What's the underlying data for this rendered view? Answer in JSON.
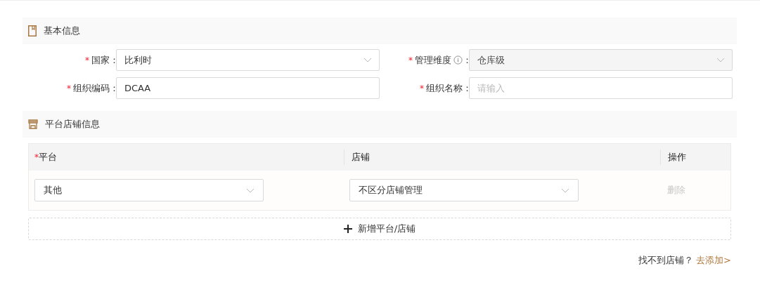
{
  "required_mark": "*",
  "colon": "：",
  "basic_section": {
    "title": "基本信息",
    "fields": [
      {
        "label": "国家",
        "required": true,
        "kind": "select",
        "value": "比利时",
        "disabled": false
      },
      {
        "label": "管理维度",
        "required": true,
        "kind": "select",
        "value": "仓库级",
        "disabled": true,
        "info": true
      },
      {
        "label": "组织编码",
        "required": true,
        "kind": "input",
        "value": "DCAA",
        "disabled": false
      },
      {
        "label": "组织名称",
        "required": true,
        "kind": "input",
        "placeholder": "请输入",
        "disabled": false
      }
    ]
  },
  "shop_section": {
    "title": "平台店铺信息",
    "table": {
      "columns": [
        {
          "label": "平台",
          "required": true
        },
        {
          "label": "店铺",
          "required": false
        },
        {
          "label": "操作",
          "required": false
        }
      ],
      "rows": [
        {
          "platform": "其他",
          "shop": "不区分店铺管理",
          "action": "删除",
          "action_disabled": true
        }
      ]
    },
    "add_button": "新增平台/店铺"
  },
  "footer": {
    "text": "找不到店铺？",
    "link": "去添加>"
  }
}
